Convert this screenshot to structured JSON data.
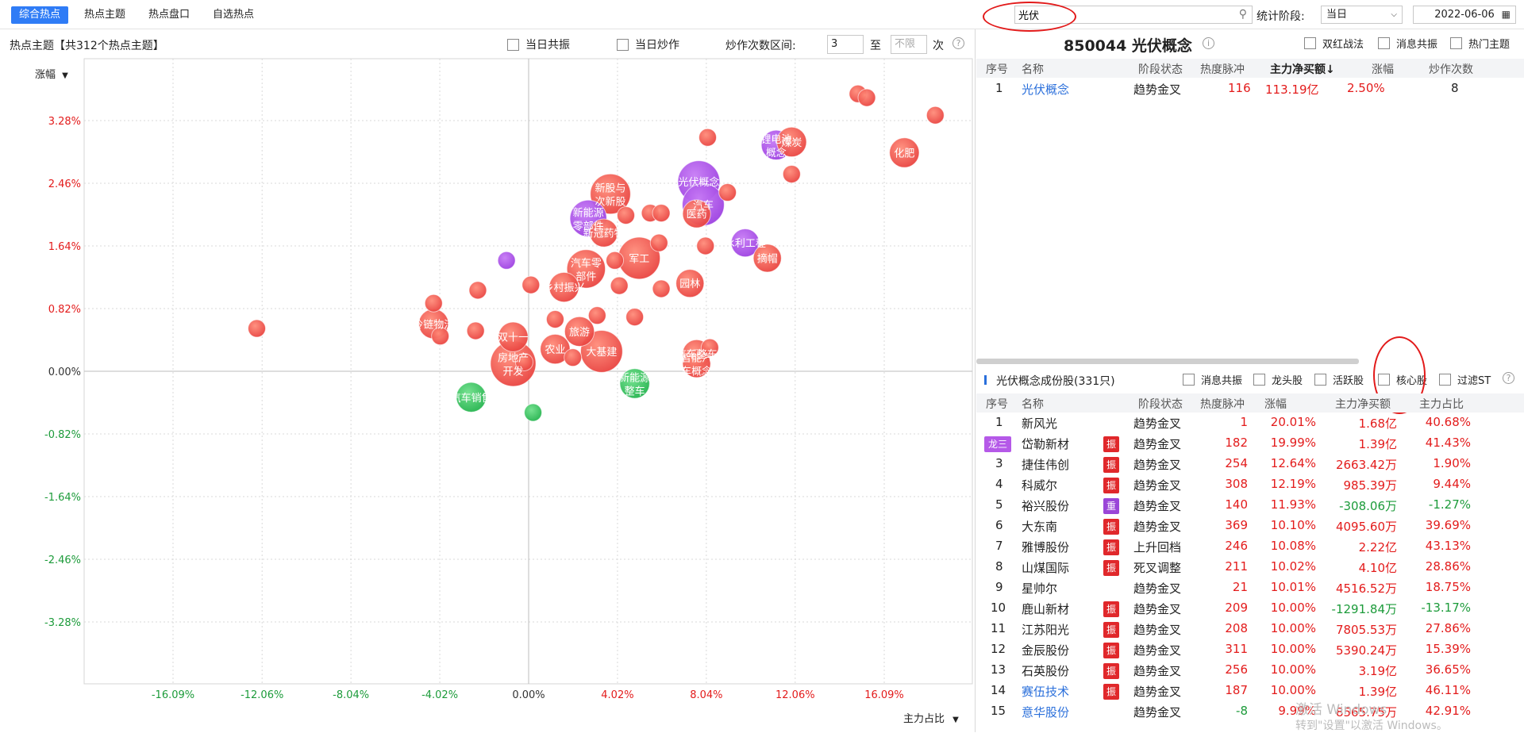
{
  "top_tabs": [
    "综合热点",
    "热点主题",
    "热点盘口",
    "自选热点"
  ],
  "search": {
    "value": "光伏"
  },
  "period": {
    "label": "统计阶段:",
    "value": "当日"
  },
  "date": "2022-06-06",
  "left_panel": {
    "title": "热点主题【共312个热点主题】",
    "cb_resonance": "当日共振",
    "cb_speculated": "当日炒作",
    "range_label": "炒作次数区间:",
    "range_from": "3",
    "range_to_label": "至",
    "range_to_placeholder": "不限",
    "range_unit": "次",
    "y_selector": "涨幅",
    "x_selector": "主力占比"
  },
  "chart_data": {
    "type": "scatter",
    "xlabel": "主力占比",
    "ylabel": "涨幅",
    "x_ticks": [
      "-16.09%",
      "-12.06%",
      "-8.04%",
      "-4.02%",
      "0.00%",
      "4.02%",
      "8.04%",
      "12.06%",
      "16.09%"
    ],
    "y_ticks": [
      "3.28%",
      "2.46%",
      "1.64%",
      "0.82%",
      "0.00%",
      "-0.82%",
      "-1.64%",
      "-2.46%",
      "-3.28%"
    ],
    "x_tick_values": [
      -16.09,
      -12.06,
      -8.04,
      -4.02,
      0,
      4.02,
      8.04,
      12.06,
      16.09
    ],
    "y_tick_values": [
      3.28,
      2.46,
      1.64,
      0.82,
      0,
      -0.82,
      -1.64,
      -2.46,
      -3.28
    ],
    "colors": {
      "red": "#e8403d",
      "purple": "#9b3ee0",
      "green": "#22b24c"
    },
    "points": [
      {
        "x": 14.9,
        "y": 3.63,
        "s": 1,
        "c": "red",
        "label": ""
      },
      {
        "x": 15.3,
        "y": 3.58,
        "s": 1,
        "c": "red",
        "label": ""
      },
      {
        "x": 18.4,
        "y": 3.35,
        "s": 1,
        "c": "red",
        "label": ""
      },
      {
        "x": 8.1,
        "y": 3.06,
        "s": 1,
        "c": "red",
        "label": ""
      },
      {
        "x": 11.2,
        "y": 2.96,
        "s": 1.7,
        "c": "purple",
        "label": "锂电池概念"
      },
      {
        "x": 11.9,
        "y": 3.0,
        "s": 1.7,
        "c": "red",
        "label": "煤炭"
      },
      {
        "x": 17.0,
        "y": 2.86,
        "s": 1.7,
        "c": "red",
        "label": "化肥"
      },
      {
        "x": 11.9,
        "y": 2.58,
        "s": 1,
        "c": "red",
        "label": ""
      },
      {
        "x": 7.7,
        "y": 2.48,
        "s": 2.4,
        "c": "purple",
        "label": "光伏概念"
      },
      {
        "x": 7.9,
        "y": 2.18,
        "s": 2.4,
        "c": "purple",
        "label": "汽车"
      },
      {
        "x": 9.0,
        "y": 2.34,
        "s": 1,
        "c": "red",
        "label": ""
      },
      {
        "x": 7.6,
        "y": 2.06,
        "s": 1.6,
        "c": "red",
        "label": "医药"
      },
      {
        "x": 3.7,
        "y": 2.32,
        "s": 2.3,
        "c": "red",
        "label": "新股与次新股"
      },
      {
        "x": 2.7,
        "y": 2.0,
        "s": 2.1,
        "c": "purple",
        "label": "新能源零部件"
      },
      {
        "x": 3.4,
        "y": 1.81,
        "s": 1.6,
        "c": "red",
        "label": "新冠药物"
      },
      {
        "x": 5.5,
        "y": 2.07,
        "s": 1,
        "c": "red",
        "label": ""
      },
      {
        "x": 6.0,
        "y": 2.07,
        "s": 1,
        "c": "red",
        "label": ""
      },
      {
        "x": 4.4,
        "y": 2.04,
        "s": 1,
        "c": "red",
        "label": ""
      },
      {
        "x": 9.8,
        "y": 1.68,
        "s": 1.6,
        "c": "purple",
        "label": "水利工程"
      },
      {
        "x": 10.8,
        "y": 1.48,
        "s": 1.6,
        "c": "red",
        "label": "摘帽"
      },
      {
        "x": 8.0,
        "y": 1.64,
        "s": 1,
        "c": "red",
        "label": ""
      },
      {
        "x": 5.0,
        "y": 1.48,
        "s": 2.4,
        "c": "red",
        "label": "军工"
      },
      {
        "x": 5.9,
        "y": 1.68,
        "s": 1,
        "c": "red",
        "label": ""
      },
      {
        "x": 2.6,
        "y": 1.34,
        "s": 2.2,
        "c": "red",
        "label": "汽车零部件"
      },
      {
        "x": 7.3,
        "y": 1.15,
        "s": 1.6,
        "c": "red",
        "label": "园林"
      },
      {
        "x": 6.0,
        "y": 1.08,
        "s": 1,
        "c": "red",
        "label": ""
      },
      {
        "x": 3.9,
        "y": 1.45,
        "s": 1,
        "c": "red",
        "label": ""
      },
      {
        "x": 1.6,
        "y": 1.1,
        "s": 1.7,
        "c": "red",
        "label": "乡村振兴"
      },
      {
        "x": 4.1,
        "y": 1.12,
        "s": 1,
        "c": "red",
        "label": ""
      },
      {
        "x": 0.1,
        "y": 1.13,
        "s": 1,
        "c": "red",
        "label": ""
      },
      {
        "x": -1.0,
        "y": 1.45,
        "s": 1,
        "c": "purple",
        "label": ""
      },
      {
        "x": -2.3,
        "y": 1.06,
        "s": 1,
        "c": "red",
        "label": ""
      },
      {
        "x": -4.3,
        "y": 0.89,
        "s": 1,
        "c": "red",
        "label": ""
      },
      {
        "x": -4.3,
        "y": 0.62,
        "s": 1.7,
        "c": "red",
        "label": "冷链物流"
      },
      {
        "x": -4.0,
        "y": 0.46,
        "s": 1,
        "c": "red",
        "label": ""
      },
      {
        "x": -12.3,
        "y": 0.56,
        "s": 1,
        "c": "red",
        "label": ""
      },
      {
        "x": -2.4,
        "y": 0.53,
        "s": 1,
        "c": "red",
        "label": ""
      },
      {
        "x": 2.3,
        "y": 0.52,
        "s": 1.7,
        "c": "red",
        "label": "旅游"
      },
      {
        "x": 3.1,
        "y": 0.73,
        "s": 1,
        "c": "red",
        "label": ""
      },
      {
        "x": 4.8,
        "y": 0.71,
        "s": 1,
        "c": "red",
        "label": ""
      },
      {
        "x": 1.2,
        "y": 0.68,
        "s": 1,
        "c": "red",
        "label": ""
      },
      {
        "x": 1.2,
        "y": 0.29,
        "s": 1.7,
        "c": "red",
        "label": "农业"
      },
      {
        "x": -0.7,
        "y": 0.45,
        "s": 1.7,
        "c": "red",
        "label": "双十一"
      },
      {
        "x": -0.7,
        "y": 0.1,
        "s": 2.6,
        "c": "red",
        "label": "房地产开发"
      },
      {
        "x": 3.3,
        "y": 0.26,
        "s": 2.4,
        "c": "red",
        "label": "大基建"
      },
      {
        "x": 7.6,
        "y": 0.23,
        "s": 1.6,
        "c": "red",
        "label": "汽车整车"
      },
      {
        "x": 7.6,
        "y": 0.1,
        "s": 1.6,
        "c": "red",
        "label": "智能汽车概念"
      },
      {
        "x": 8.2,
        "y": 0.31,
        "s": 1,
        "c": "red",
        "label": ""
      },
      {
        "x": -0.2,
        "y": 0.12,
        "s": 1,
        "c": "red",
        "label": ""
      },
      {
        "x": 2.0,
        "y": 0.18,
        "s": 1,
        "c": "red",
        "label": ""
      },
      {
        "x": 4.8,
        "y": -0.16,
        "s": 1.7,
        "c": "green",
        "label": "新能源整车"
      },
      {
        "x": -2.6,
        "y": -0.34,
        "s": 1.7,
        "c": "green",
        "label": "汽车销售"
      },
      {
        "x": 0.2,
        "y": -0.54,
        "s": 1,
        "c": "green",
        "label": ""
      }
    ]
  },
  "right_top": {
    "title": "850044 光伏概念",
    "cb_double_red": "双红战法",
    "cb_news": "消息共振",
    "cb_hot": "热门主题",
    "headers": [
      "序号",
      "名称",
      "阶段状态",
      "热度脉冲",
      "主力净买额↓",
      "涨幅",
      "炒作次数"
    ],
    "rows": [
      {
        "no": "1",
        "name": "光伏概念",
        "state": "趋势金叉",
        "pulse": "116",
        "net": "113.19亿",
        "chg": "2.50%",
        "times": "8"
      }
    ]
  },
  "right_bottom": {
    "title": "光伏概念成份股(331只)",
    "cb_news": "消息共振",
    "cb_leader": "龙头股",
    "cb_active": "活跃股",
    "cb_core": "核心股",
    "cb_st": "过滤ST",
    "headers": [
      "序号",
      "名称",
      "阶段状态",
      "热度脉冲",
      "涨幅",
      "主力净买额",
      "主力占比"
    ],
    "rows": [
      {
        "no": "1",
        "name": "新风光",
        "tag": "",
        "state": "趋势金叉",
        "pulse": "1",
        "chg": "20.01%",
        "net": "1.68亿",
        "ratio": "40.68%",
        "blue": false
      },
      {
        "no": "龙三",
        "name": "岱勒新材",
        "tag": "振",
        "state": "趋势金叉",
        "pulse": "182",
        "chg": "19.99%",
        "net": "1.39亿",
        "ratio": "41.43%",
        "blue": false
      },
      {
        "no": "3",
        "name": "捷佳伟创",
        "tag": "振",
        "state": "趋势金叉",
        "pulse": "254",
        "chg": "12.64%",
        "net": "2663.42万",
        "ratio": "1.90%",
        "blue": false
      },
      {
        "no": "4",
        "name": "科威尔",
        "tag": "振",
        "state": "趋势金叉",
        "pulse": "308",
        "chg": "12.19%",
        "net": "985.39万",
        "ratio": "9.44%",
        "blue": false
      },
      {
        "no": "5",
        "name": "裕兴股份",
        "tag": "重",
        "state": "趋势金叉",
        "pulse": "140",
        "chg": "11.93%",
        "net": "-308.06万",
        "ratio": "-1.27%",
        "blue": false
      },
      {
        "no": "6",
        "name": "大东南",
        "tag": "振",
        "state": "趋势金叉",
        "pulse": "369",
        "chg": "10.10%",
        "net": "4095.60万",
        "ratio": "39.69%",
        "blue": false
      },
      {
        "no": "7",
        "name": "雅博股份",
        "tag": "振",
        "state": "上升回档",
        "pulse": "246",
        "chg": "10.08%",
        "net": "2.22亿",
        "ratio": "43.13%",
        "blue": false
      },
      {
        "no": "8",
        "name": "山煤国际",
        "tag": "振",
        "state": "死叉调整",
        "pulse": "211",
        "chg": "10.02%",
        "net": "4.10亿",
        "ratio": "28.86%",
        "blue": false
      },
      {
        "no": "9",
        "name": "星帅尔",
        "tag": "",
        "state": "趋势金叉",
        "pulse": "21",
        "chg": "10.01%",
        "net": "4516.52万",
        "ratio": "18.75%",
        "blue": false
      },
      {
        "no": "10",
        "name": "鹿山新材",
        "tag": "振",
        "state": "趋势金叉",
        "pulse": "209",
        "chg": "10.00%",
        "net": "-1291.84万",
        "ratio": "-13.17%",
        "blue": false
      },
      {
        "no": "11",
        "name": "江苏阳光",
        "tag": "振",
        "state": "趋势金叉",
        "pulse": "208",
        "chg": "10.00%",
        "net": "7805.53万",
        "ratio": "27.86%",
        "blue": false
      },
      {
        "no": "12",
        "name": "金辰股份",
        "tag": "振",
        "state": "趋势金叉",
        "pulse": "311",
        "chg": "10.00%",
        "net": "5390.24万",
        "ratio": "15.39%",
        "blue": false
      },
      {
        "no": "13",
        "name": "石英股份",
        "tag": "振",
        "state": "趋势金叉",
        "pulse": "256",
        "chg": "10.00%",
        "net": "3.19亿",
        "ratio": "36.65%",
        "blue": false
      },
      {
        "no": "14",
        "name": "赛伍技术",
        "tag": "振",
        "state": "趋势金叉",
        "pulse": "187",
        "chg": "10.00%",
        "net": "1.39亿",
        "ratio": "46.11%",
        "blue": true
      },
      {
        "no": "15",
        "name": "意华股份",
        "tag": "",
        "state": "趋势金叉",
        "pulse": "-8",
        "chg": "9.99%",
        "net": "8565.75万",
        "ratio": "42.91%",
        "blue": true
      }
    ]
  },
  "watermark": {
    "line1": "激活 Windows",
    "line2": "转到\"设置\"以激活 Windows。"
  }
}
